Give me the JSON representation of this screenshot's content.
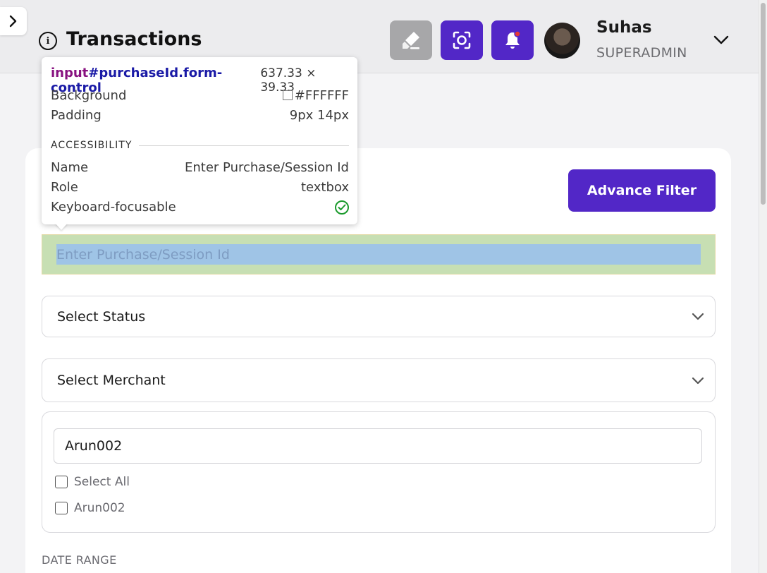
{
  "header": {
    "title": "Transactions",
    "user": {
      "name": "Suhas",
      "role": "SUPERADMIN"
    },
    "icons": {
      "sidebar_toggle": "chevron-right-icon",
      "info": "info-icon",
      "clean": "eraser-icon",
      "screenshot": "screenshot-icon",
      "bell": "bell-icon",
      "user_menu": "chevron-down-icon"
    },
    "notification_dot_color": "#e53935"
  },
  "filters": {
    "advance_filter_label": "Advance Filter",
    "purchase_id_placeholder": "Enter Purchase/Session Id",
    "status_select_label": "Select Status",
    "merchant_select_label": "Select Merchant",
    "merchant_search_value": "Arun002",
    "merchant_options": [
      "Select All",
      "Arun002"
    ],
    "date_range_label": "DATE RANGE"
  },
  "inspector": {
    "tag": "input",
    "selector": "#purchaseId.form-control",
    "dimensions": "637.33 × 39.33",
    "background_label": "Background",
    "background_value": "#FFFFFF",
    "padding_label": "Padding",
    "padding_value": "9px 14px",
    "section_title": "ACCESSIBILITY",
    "name_label": "Name",
    "name_value": "Enter Purchase/Session Id",
    "role_label": "Role",
    "role_value": "textbox",
    "focusable_label": "Keyboard-focusable"
  },
  "colors": {
    "accent": "#5227c7",
    "highlight_margin": "#c7dfb3",
    "highlight_content": "#9fc4e6"
  }
}
